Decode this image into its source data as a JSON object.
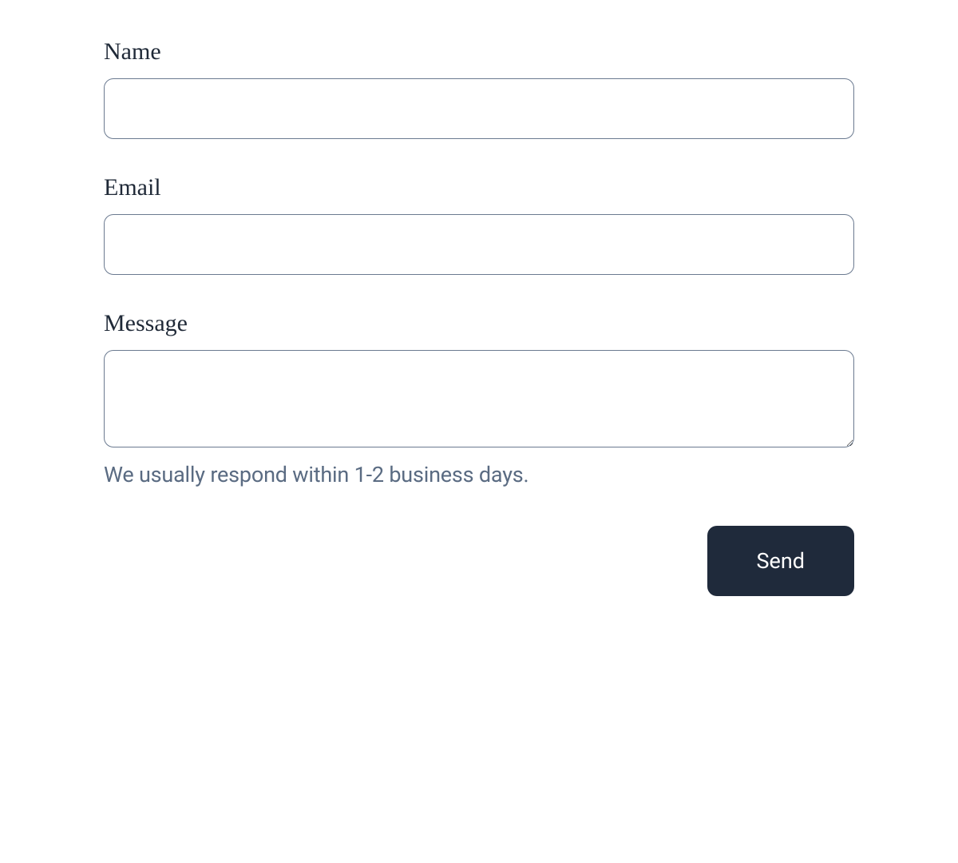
{
  "form": {
    "name_label": "Name",
    "name_value": "",
    "email_label": "Email",
    "email_value": "",
    "message_label": "Message",
    "message_value": "",
    "help_text": "We usually respond within 1-2 business days.",
    "submit_label": "Send"
  }
}
